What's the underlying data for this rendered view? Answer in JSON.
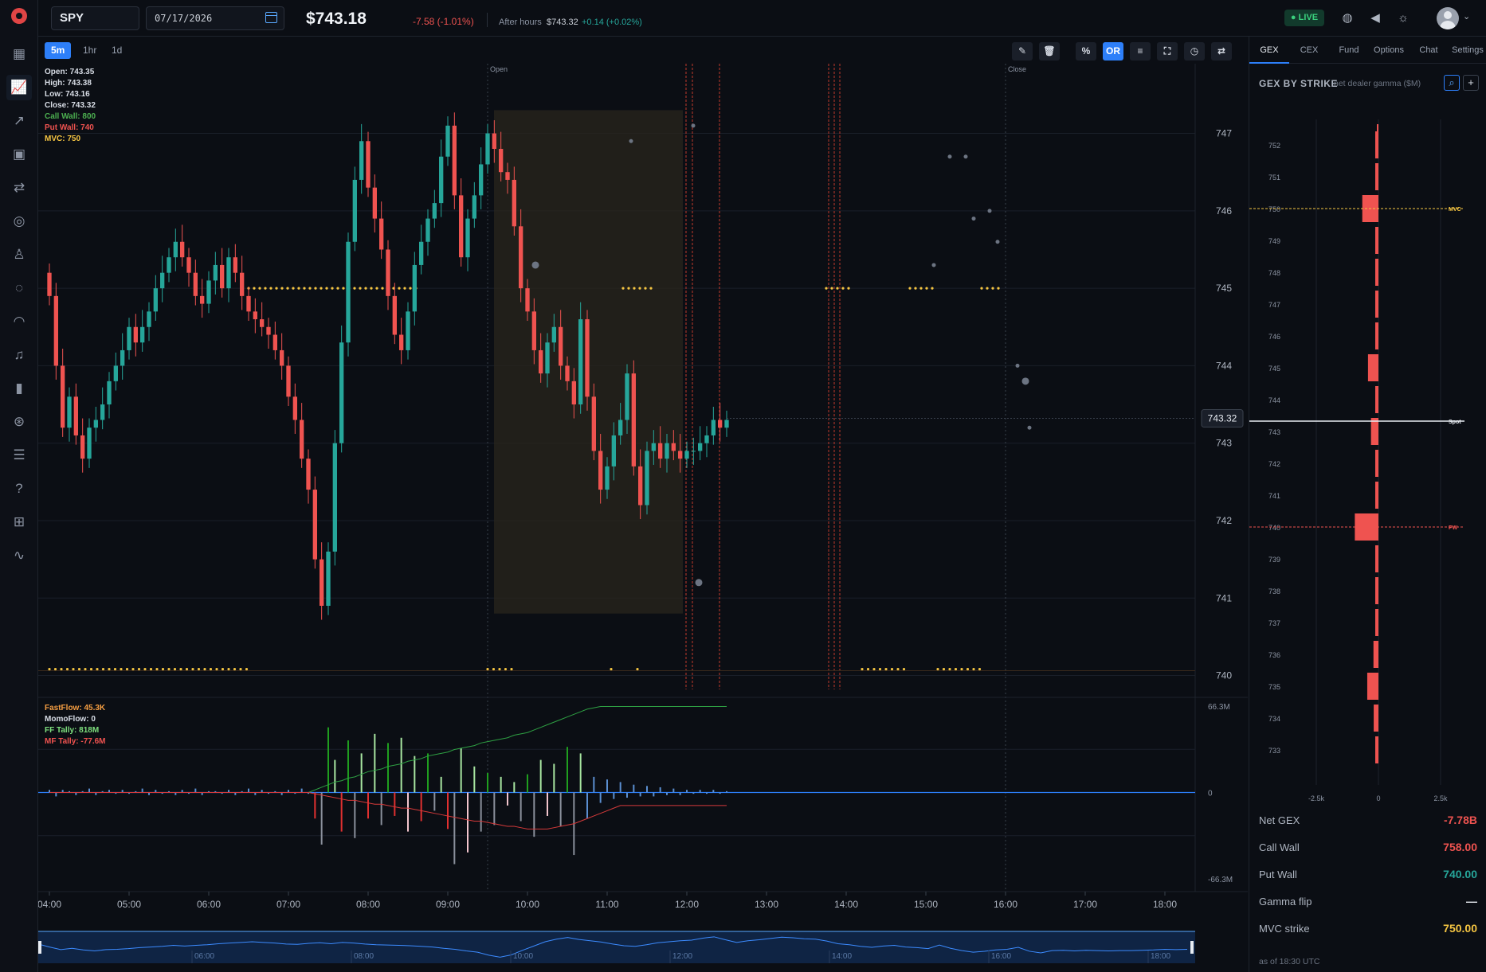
{
  "sidebar": {
    "items": [
      {
        "name": "logo-icon",
        "glyph": ""
      },
      {
        "name": "dashboard-grid-icon",
        "glyph": "▦"
      },
      {
        "name": "line-chart-icon",
        "glyph": "📈"
      },
      {
        "name": "analytics-chart-icon",
        "glyph": "↗"
      },
      {
        "name": "calendar-icon",
        "glyph": "▣"
      },
      {
        "name": "transfer-arrows-icon",
        "glyph": "⇄"
      },
      {
        "name": "target-icon",
        "glyph": "◎"
      },
      {
        "name": "user-icon",
        "glyph": "♙"
      },
      {
        "name": "chat-bubble-icon",
        "glyph": "◌"
      },
      {
        "name": "gauge-icon",
        "glyph": "◠"
      },
      {
        "name": "bell-icon",
        "glyph": "♫"
      },
      {
        "name": "bar-chart-icon",
        "glyph": "▮"
      },
      {
        "name": "coins-icon",
        "glyph": "⊛"
      },
      {
        "name": "document-icon",
        "glyph": "☰"
      },
      {
        "name": "help-icon",
        "glyph": "?"
      },
      {
        "name": "gift-icon",
        "glyph": "⊞"
      },
      {
        "name": "pulse-icon",
        "glyph": "∿"
      }
    ]
  },
  "topbar": {
    "ticker": "SPY",
    "date": "07/17/2026",
    "price": "$743.18",
    "change": "-7.58 (-1.01%)",
    "after_hours_label": "After hours",
    "after_hours_price": "$743.32",
    "after_hours_change": "+0.14 (+0.02%)",
    "live_label": "● LIVE"
  },
  "chart_toolbar": {
    "timeframes": [
      "5m",
      "1hr",
      "1d"
    ],
    "active_timeframe": "5m",
    "percent_label": "%",
    "or_label": "OR"
  },
  "ohlc_legend": {
    "open": "Open: 743.35",
    "high": "High: 743.38",
    "low": "Low: 743.16",
    "close": "Close: 743.32",
    "call_wall": "Call Wall: 800",
    "put_wall": "Put Wall: 740",
    "mvc": "MVC: 750"
  },
  "flow_legend": {
    "fastflow": "FastFlow: 45.3K",
    "momoflow": "MomoFlow: 0",
    "ff_tally": "FF Tally: 818M",
    "mf_tally": "MF Tally: -77.6M"
  },
  "colors": {
    "up": "#26a69a",
    "down": "#ef5350",
    "accent": "#2d7ff9",
    "mvc": "#f5c542",
    "call_wall": "#4caf50",
    "put_wall": "#ef5350"
  },
  "chart_data": [
    {
      "type": "candlestick",
      "title": "SPY 5m",
      "x_ticks": [
        "04:00",
        "05:00",
        "06:00",
        "07:00",
        "08:00",
        "09:00",
        "10:00",
        "11:00",
        "12:00",
        "13:00",
        "14:00",
        "15:00",
        "16:00",
        "17:00",
        "18:00"
      ],
      "y_ticks": [
        747,
        746,
        745,
        744,
        743,
        742,
        741,
        740
      ],
      "ylim": [
        739.8,
        747.9
      ],
      "session_markers": [
        "Open",
        "Close"
      ],
      "last_price_label": "743.32",
      "interval_minutes": 5,
      "start_time": "04:00",
      "closes": [
        744.9,
        744.0,
        743.2,
        743.6,
        743.1,
        742.8,
        743.2,
        743.3,
        743.5,
        743.8,
        744.0,
        744.2,
        744.5,
        744.3,
        744.5,
        744.7,
        745.0,
        745.2,
        745.4,
        745.6,
        745.4,
        745.2,
        744.9,
        744.8,
        745.1,
        745.3,
        745.0,
        745.4,
        745.2,
        744.9,
        744.7,
        744.6,
        744.5,
        744.4,
        744.2,
        744.0,
        743.6,
        743.3,
        742.8,
        742.4,
        741.5,
        740.9,
        741.6,
        743.0,
        744.3,
        745.6,
        746.4,
        746.9,
        746.3,
        745.9,
        745.5,
        744.9,
        744.4,
        744.2,
        744.7,
        745.3,
        745.6,
        745.9,
        746.1,
        746.7,
        747.1,
        746.2,
        745.4,
        745.9,
        746.2,
        746.6,
        747.0,
        746.8,
        746.5,
        746.4,
        745.8,
        745.0,
        744.7,
        744.2,
        743.9,
        744.3,
        744.5,
        744.0,
        743.8,
        743.5,
        744.6,
        743.6,
        742.9,
        742.4,
        742.7,
        743.1,
        743.3,
        743.9,
        742.7,
        742.2,
        742.9,
        743.0,
        742.8,
        743.0,
        742.9,
        742.8,
        742.9,
        742.9,
        743.0,
        743.1,
        743.3,
        743.2,
        743.3
      ],
      "dimension_axis": "intraday time",
      "intraday_high": 747.3,
      "intraday_low": 740.8,
      "mvc_level": 745.0,
      "put_wall_level": 740.0
    },
    {
      "type": "bar",
      "title": "Flow",
      "ylim_labels": [
        "66.3M",
        "0",
        "-66.3M"
      ],
      "ylim": [
        -66.3,
        66.3
      ],
      "unit": "M",
      "series": [
        {
          "name": "FastFlow",
          "values": [
            2,
            -3,
            2,
            1,
            -2,
            1,
            3,
            -2,
            1,
            2,
            -1,
            2,
            -1,
            1,
            3,
            -2,
            2,
            -1,
            1,
            -2,
            2,
            -1,
            3,
            -2,
            1,
            1,
            -1,
            2,
            -2,
            1,
            3,
            -2,
            2,
            -1,
            1,
            -2,
            2,
            -1,
            3,
            -1,
            -20,
            -40,
            50,
            25,
            -30,
            40,
            -35,
            30,
            -20,
            45,
            -25,
            38,
            -18,
            42,
            -30,
            28,
            -22,
            30,
            -14,
            12,
            -28,
            -55,
            34,
            -46,
            20,
            -30,
            15,
            -25,
            12,
            -10,
            8,
            -22,
            14,
            -34,
            25,
            -18,
            22,
            -26,
            35,
            -48,
            30,
            -20,
            12,
            -8,
            10,
            -5,
            8,
            -4,
            6,
            -3,
            5,
            -3,
            4,
            -2,
            3,
            -2,
            2,
            -1,
            2,
            -1,
            2,
            -1,
            1
          ]
        },
        {
          "name": "FF Tally",
          "values": [
            0,
            0,
            0,
            0,
            0,
            0,
            0,
            0,
            0,
            0,
            0,
            0,
            0,
            0,
            0,
            0,
            0,
            0,
            0,
            0,
            0,
            0,
            0,
            0,
            0,
            0,
            0,
            0,
            0,
            0,
            0,
            0,
            0,
            0,
            0,
            0,
            0,
            0,
            0,
            0,
            2,
            4,
            6,
            8,
            9,
            11,
            12,
            14,
            16,
            17,
            18,
            20,
            21,
            22,
            24,
            25,
            26,
            28,
            29,
            30,
            31,
            33,
            34,
            35,
            36,
            38,
            39,
            40,
            41,
            42,
            44,
            45,
            46,
            48,
            50,
            52,
            54,
            56,
            58,
            60,
            62,
            64,
            65,
            66,
            66,
            66,
            66,
            66,
            66,
            66,
            66,
            66,
            66,
            66,
            66,
            66,
            66,
            66,
            66,
            66,
            66,
            66,
            66
          ]
        },
        {
          "name": "MF Tally",
          "values": [
            0,
            0,
            0,
            0,
            0,
            0,
            0,
            0,
            0,
            0,
            0,
            0,
            0,
            0,
            0,
            0,
            0,
            0,
            0,
            0,
            0,
            0,
            0,
            0,
            0,
            0,
            0,
            0,
            0,
            0,
            0,
            0,
            0,
            0,
            0,
            0,
            0,
            0,
            0,
            0,
            -1,
            -2,
            -3,
            -4,
            -5,
            -6,
            -6,
            -7,
            -8,
            -9,
            -9,
            -10,
            -11,
            -12,
            -12,
            -13,
            -14,
            -15,
            -16,
            -17,
            -18,
            -19,
            -20,
            -21,
            -22,
            -22,
            -23,
            -24,
            -25,
            -26,
            -26,
            -27,
            -28,
            -28,
            -28,
            -28,
            -27,
            -26,
            -25,
            -24,
            -22,
            -20,
            -18,
            -16,
            -14,
            -12,
            -10,
            -10,
            -10,
            -10,
            -10,
            -10,
            -10,
            -10,
            -10,
            -10,
            -10,
            -10,
            -10,
            -10,
            -10,
            -10,
            -10
          ]
        }
      ]
    },
    {
      "type": "bar",
      "title": "GEX BY STRIKE",
      "subtitle": "net dealer gamma ($M)",
      "orientation": "horizontal",
      "categories": [
        "752",
        "751",
        "750",
        "749",
        "748",
        "747",
        "746",
        "745",
        "744",
        "743",
        "742",
        "741",
        "740",
        "739",
        "738",
        "737",
        "736",
        "735",
        "734",
        "733"
      ],
      "values": [
        -20,
        -25,
        -650,
        -30,
        -40,
        -45,
        -50,
        -420,
        -25,
        -300,
        -35,
        -30,
        -950,
        -55,
        -60,
        -70,
        -200,
        -450,
        -190,
        -120
      ],
      "x_ticks": [
        "-2.5k",
        "0",
        "2.5k"
      ],
      "xlim": [
        -3000,
        3000
      ],
      "markers": [
        {
          "strike": "750",
          "label": "MVC"
        },
        {
          "strike": "743",
          "label": "Spot",
          "at": 743.3
        },
        {
          "strike": "740",
          "label": "PW"
        }
      ]
    }
  ],
  "right_panel": {
    "tabs": [
      "GEX",
      "CEX",
      "Fund",
      "Options",
      "Chat",
      "Settings"
    ],
    "active_tab": "GEX",
    "gex_title": "GEX BY STRIKE",
    "gex_subtitle": "net dealer gamma ($M)",
    "stats": [
      {
        "label": "Net GEX",
        "value": "-7.78B",
        "color": "#ef5350"
      },
      {
        "label": "Call Wall",
        "value": "758.00",
        "color": "#ef5350"
      },
      {
        "label": "Put Wall",
        "value": "740.00",
        "color": "#26a69a"
      },
      {
        "label": "Gamma flip",
        "value": "—",
        "color": "#e8ecf2"
      },
      {
        "label": "MVC strike",
        "value": "750.00",
        "color": "#f5c542"
      }
    ],
    "as_of": "as of 18:30 UTC"
  },
  "navigator": {
    "labels": [
      "06:00",
      "08:00",
      "10:00",
      "12:00",
      "14:00",
      "16:00",
      "18:00"
    ]
  }
}
